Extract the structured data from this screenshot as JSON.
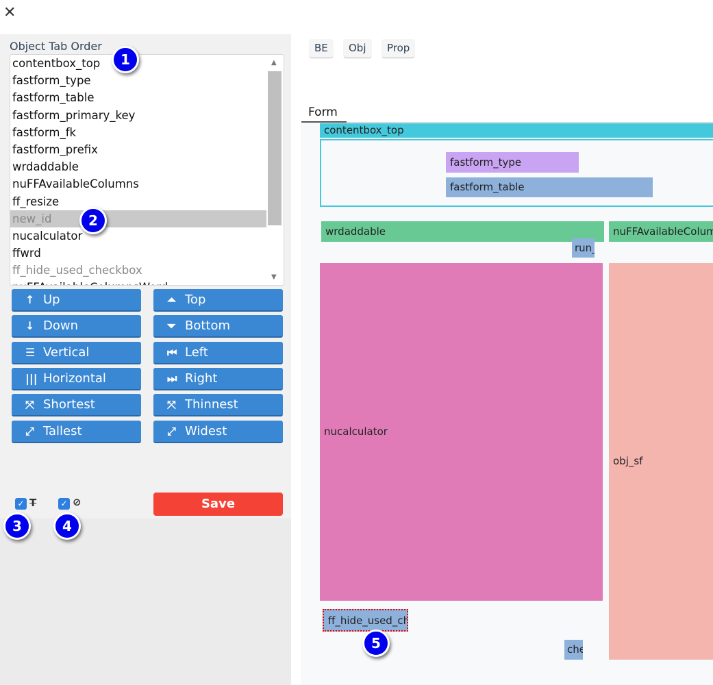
{
  "window": {
    "close_icon": "close-icon"
  },
  "tab_order": {
    "label": "Object Tab Order",
    "items": [
      {
        "label": "contentbox_top",
        "state": "normal"
      },
      {
        "label": "fastform_type",
        "state": "normal"
      },
      {
        "label": "fastform_table",
        "state": "normal"
      },
      {
        "label": "fastform_primary_key",
        "state": "normal"
      },
      {
        "label": "fastform_fk",
        "state": "normal"
      },
      {
        "label": "fastform_prefix",
        "state": "normal"
      },
      {
        "label": "wrdaddable",
        "state": "normal"
      },
      {
        "label": "nuFFAvailableColumns",
        "state": "normal"
      },
      {
        "label": "ff_resize",
        "state": "normal"
      },
      {
        "label": "new_id",
        "state": "selected"
      },
      {
        "label": "nucalculator",
        "state": "normal"
      },
      {
        "label": "ffwrd",
        "state": "normal"
      },
      {
        "label": "ff_hide_used_checkbox",
        "state": "dim"
      },
      {
        "label": "nuFFAvailableColumnsWord",
        "state": "normal"
      }
    ]
  },
  "buttons": [
    {
      "label": "Up",
      "icon": "↑",
      "name": "arrow-up-icon"
    },
    {
      "label": "Top",
      "icon": "⏶",
      "name": "move-top-icon"
    },
    {
      "label": "Down",
      "icon": "↓",
      "name": "arrow-down-icon"
    },
    {
      "label": "Bottom",
      "icon": "⏷",
      "name": "move-bottom-icon"
    },
    {
      "label": "Vertical",
      "icon": "☰",
      "name": "align-vertical-icon"
    },
    {
      "label": "Left",
      "icon": "⏮",
      "name": "align-left-icon"
    },
    {
      "label": "Horizontal",
      "icon": "|||",
      "name": "align-horizontal-icon"
    },
    {
      "label": "Right",
      "icon": "⏭",
      "name": "align-right-icon"
    },
    {
      "label": "Shortest",
      "icon": "⤧",
      "name": "compress-icon"
    },
    {
      "label": "Thinnest",
      "icon": "⤧",
      "name": "compress-icon"
    },
    {
      "label": "Tallest",
      "icon": "⤢",
      "name": "expand-icon"
    },
    {
      "label": "Widest",
      "icon": "⤢",
      "name": "expand-icon"
    }
  ],
  "options": {
    "hide_text_checked": true,
    "hide_text_icon": "text-slash-icon",
    "hide_hidden_checked": true,
    "hide_hidden_icon": "eye-slash-icon"
  },
  "save_label": "Save",
  "top_buttons": [
    "BE",
    "Obj",
    "Prop"
  ],
  "form_tab": "Form",
  "blocks": {
    "contentbox_top": "contentbox_top",
    "fastform_type": "fastform_type",
    "fastform_table": "fastform_table",
    "wrdaddable": "wrdaddable",
    "nuFFAvailableColumns": "nuFFAvailableColumns",
    "run": "run_",
    "nucalculator": "nucalculator",
    "obj_sf": "obj_sf",
    "ff_hide_used_checkbox": "ff_hide_used_checkbox",
    "che": "checkbox"
  },
  "colors": {
    "cyan": "#44c9dc",
    "purple": "#c9a4f2",
    "blue": "#8db1db",
    "green": "#68c994",
    "pink": "#e07bb7",
    "salmon": "#f4b5ae",
    "button": "#3a87d3",
    "save": "#f44336",
    "badge": "#0000ee"
  },
  "badges": [
    "1",
    "2",
    "3",
    "4",
    "5"
  ]
}
